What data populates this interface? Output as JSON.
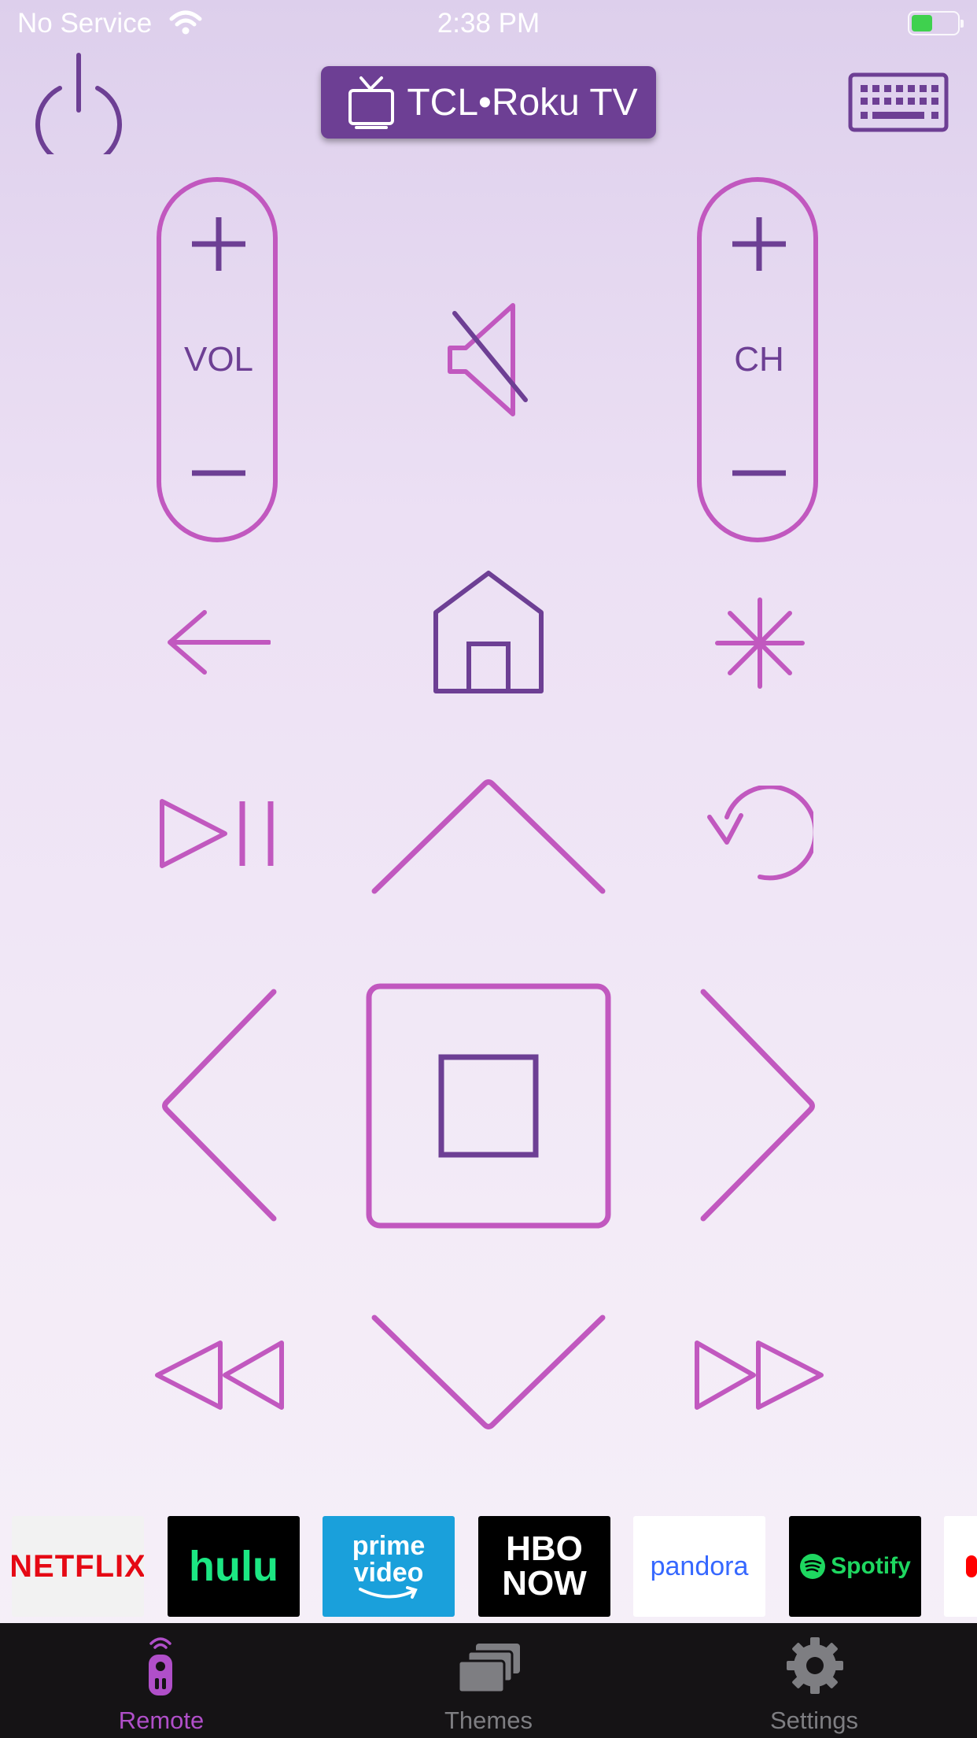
{
  "status_bar": {
    "carrier": "No Service",
    "time": "2:38 PM"
  },
  "header": {
    "device_name": "TCL•Roku TV"
  },
  "remote": {
    "volume_label": "VOL",
    "channel_label": "CH"
  },
  "apps": [
    {
      "name": "NETFLIX",
      "bg": "#f2f2f2",
      "color": "#e50914"
    },
    {
      "name": "hulu",
      "bg": "#000000",
      "color": "#1ce783"
    },
    {
      "name": "prime video",
      "bg": "#1aa0db",
      "color": "#ffffff"
    },
    {
      "name": "HBO NOW",
      "bg": "#000000",
      "color": "#ffffff"
    },
    {
      "name": "pandora",
      "bg": "#ffffff",
      "color": "#3668ff"
    },
    {
      "name": "Spotify",
      "bg": "#000000",
      "color": "#1ed760"
    }
  ],
  "tab_bar": {
    "tabs": [
      {
        "label": "Remote",
        "icon": "remote-icon",
        "active": true
      },
      {
        "label": "Themes",
        "icon": "themes-icon",
        "active": false
      },
      {
        "label": "Settings",
        "icon": "gear-icon",
        "active": false
      }
    ]
  },
  "colors": {
    "accent_pink": "#c158bf",
    "accent_purple": "#6d3f94",
    "tab_active": "#b04fc9"
  }
}
